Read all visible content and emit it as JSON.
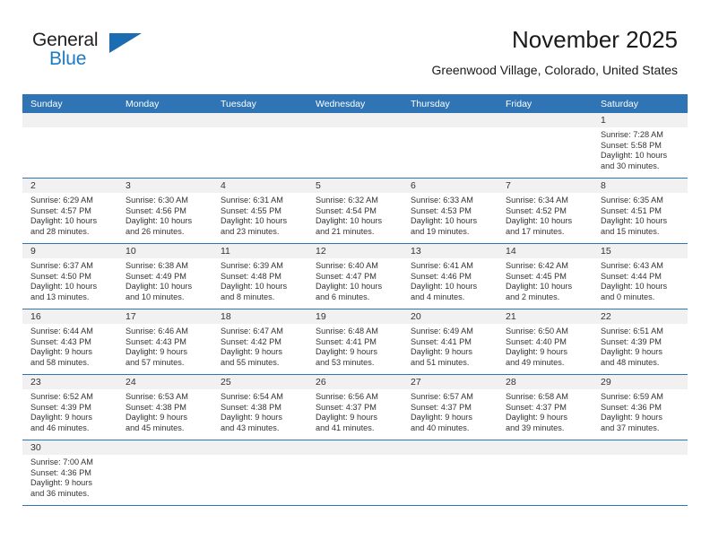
{
  "brand": {
    "name_top": "General",
    "name_bottom": "Blue",
    "accent_color": "#1b6cb0"
  },
  "header": {
    "title": "November 2025",
    "subtitle": "Greenwood Village, Colorado, United States"
  },
  "theme": {
    "header_row_bg": "#2f74b5",
    "daynum_bg": "#f1f1f1",
    "row_divider": "#2f74b5",
    "text": "#333333"
  },
  "weekday_headers": [
    "Sunday",
    "Monday",
    "Tuesday",
    "Wednesday",
    "Thursday",
    "Friday",
    "Saturday"
  ],
  "labels": {
    "sunrise": "Sunrise:",
    "sunset": "Sunset:",
    "daylight": "Daylight:"
  },
  "weeks": [
    [
      {
        "day": "",
        "blank": true
      },
      {
        "day": "",
        "blank": true
      },
      {
        "day": "",
        "blank": true
      },
      {
        "day": "",
        "blank": true
      },
      {
        "day": "",
        "blank": true
      },
      {
        "day": "",
        "blank": true
      },
      {
        "day": "1",
        "sunrise": "Sunrise: 7:28 AM",
        "sunset": "Sunset: 5:58 PM",
        "daylight1": "Daylight: 10 hours",
        "daylight2": "and 30 minutes."
      }
    ],
    [
      {
        "day": "2",
        "sunrise": "Sunrise: 6:29 AM",
        "sunset": "Sunset: 4:57 PM",
        "daylight1": "Daylight: 10 hours",
        "daylight2": "and 28 minutes."
      },
      {
        "day": "3",
        "sunrise": "Sunrise: 6:30 AM",
        "sunset": "Sunset: 4:56 PM",
        "daylight1": "Daylight: 10 hours",
        "daylight2": "and 26 minutes."
      },
      {
        "day": "4",
        "sunrise": "Sunrise: 6:31 AM",
        "sunset": "Sunset: 4:55 PM",
        "daylight1": "Daylight: 10 hours",
        "daylight2": "and 23 minutes."
      },
      {
        "day": "5",
        "sunrise": "Sunrise: 6:32 AM",
        "sunset": "Sunset: 4:54 PM",
        "daylight1": "Daylight: 10 hours",
        "daylight2": "and 21 minutes."
      },
      {
        "day": "6",
        "sunrise": "Sunrise: 6:33 AM",
        "sunset": "Sunset: 4:53 PM",
        "daylight1": "Daylight: 10 hours",
        "daylight2": "and 19 minutes."
      },
      {
        "day": "7",
        "sunrise": "Sunrise: 6:34 AM",
        "sunset": "Sunset: 4:52 PM",
        "daylight1": "Daylight: 10 hours",
        "daylight2": "and 17 minutes."
      },
      {
        "day": "8",
        "sunrise": "Sunrise: 6:35 AM",
        "sunset": "Sunset: 4:51 PM",
        "daylight1": "Daylight: 10 hours",
        "daylight2": "and 15 minutes."
      }
    ],
    [
      {
        "day": "9",
        "sunrise": "Sunrise: 6:37 AM",
        "sunset": "Sunset: 4:50 PM",
        "daylight1": "Daylight: 10 hours",
        "daylight2": "and 13 minutes."
      },
      {
        "day": "10",
        "sunrise": "Sunrise: 6:38 AM",
        "sunset": "Sunset: 4:49 PM",
        "daylight1": "Daylight: 10 hours",
        "daylight2": "and 10 minutes."
      },
      {
        "day": "11",
        "sunrise": "Sunrise: 6:39 AM",
        "sunset": "Sunset: 4:48 PM",
        "daylight1": "Daylight: 10 hours",
        "daylight2": "and 8 minutes."
      },
      {
        "day": "12",
        "sunrise": "Sunrise: 6:40 AM",
        "sunset": "Sunset: 4:47 PM",
        "daylight1": "Daylight: 10 hours",
        "daylight2": "and 6 minutes."
      },
      {
        "day": "13",
        "sunrise": "Sunrise: 6:41 AM",
        "sunset": "Sunset: 4:46 PM",
        "daylight1": "Daylight: 10 hours",
        "daylight2": "and 4 minutes."
      },
      {
        "day": "14",
        "sunrise": "Sunrise: 6:42 AM",
        "sunset": "Sunset: 4:45 PM",
        "daylight1": "Daylight: 10 hours",
        "daylight2": "and 2 minutes."
      },
      {
        "day": "15",
        "sunrise": "Sunrise: 6:43 AM",
        "sunset": "Sunset: 4:44 PM",
        "daylight1": "Daylight: 10 hours",
        "daylight2": "and 0 minutes."
      }
    ],
    [
      {
        "day": "16",
        "sunrise": "Sunrise: 6:44 AM",
        "sunset": "Sunset: 4:43 PM",
        "daylight1": "Daylight: 9 hours",
        "daylight2": "and 58 minutes."
      },
      {
        "day": "17",
        "sunrise": "Sunrise: 6:46 AM",
        "sunset": "Sunset: 4:43 PM",
        "daylight1": "Daylight: 9 hours",
        "daylight2": "and 57 minutes."
      },
      {
        "day": "18",
        "sunrise": "Sunrise: 6:47 AM",
        "sunset": "Sunset: 4:42 PM",
        "daylight1": "Daylight: 9 hours",
        "daylight2": "and 55 minutes."
      },
      {
        "day": "19",
        "sunrise": "Sunrise: 6:48 AM",
        "sunset": "Sunset: 4:41 PM",
        "daylight1": "Daylight: 9 hours",
        "daylight2": "and 53 minutes."
      },
      {
        "day": "20",
        "sunrise": "Sunrise: 6:49 AM",
        "sunset": "Sunset: 4:41 PM",
        "daylight1": "Daylight: 9 hours",
        "daylight2": "and 51 minutes."
      },
      {
        "day": "21",
        "sunrise": "Sunrise: 6:50 AM",
        "sunset": "Sunset: 4:40 PM",
        "daylight1": "Daylight: 9 hours",
        "daylight2": "and 49 minutes."
      },
      {
        "day": "22",
        "sunrise": "Sunrise: 6:51 AM",
        "sunset": "Sunset: 4:39 PM",
        "daylight1": "Daylight: 9 hours",
        "daylight2": "and 48 minutes."
      }
    ],
    [
      {
        "day": "23",
        "sunrise": "Sunrise: 6:52 AM",
        "sunset": "Sunset: 4:39 PM",
        "daylight1": "Daylight: 9 hours",
        "daylight2": "and 46 minutes."
      },
      {
        "day": "24",
        "sunrise": "Sunrise: 6:53 AM",
        "sunset": "Sunset: 4:38 PM",
        "daylight1": "Daylight: 9 hours",
        "daylight2": "and 45 minutes."
      },
      {
        "day": "25",
        "sunrise": "Sunrise: 6:54 AM",
        "sunset": "Sunset: 4:38 PM",
        "daylight1": "Daylight: 9 hours",
        "daylight2": "and 43 minutes."
      },
      {
        "day": "26",
        "sunrise": "Sunrise: 6:56 AM",
        "sunset": "Sunset: 4:37 PM",
        "daylight1": "Daylight: 9 hours",
        "daylight2": "and 41 minutes."
      },
      {
        "day": "27",
        "sunrise": "Sunrise: 6:57 AM",
        "sunset": "Sunset: 4:37 PM",
        "daylight1": "Daylight: 9 hours",
        "daylight2": "and 40 minutes."
      },
      {
        "day": "28",
        "sunrise": "Sunrise: 6:58 AM",
        "sunset": "Sunset: 4:37 PM",
        "daylight1": "Daylight: 9 hours",
        "daylight2": "and 39 minutes."
      },
      {
        "day": "29",
        "sunrise": "Sunrise: 6:59 AM",
        "sunset": "Sunset: 4:36 PM",
        "daylight1": "Daylight: 9 hours",
        "daylight2": "and 37 minutes."
      }
    ],
    [
      {
        "day": "30",
        "sunrise": "Sunrise: 7:00 AM",
        "sunset": "Sunset: 4:36 PM",
        "daylight1": "Daylight: 9 hours",
        "daylight2": "and 36 minutes."
      },
      {
        "day": "",
        "blank": true
      },
      {
        "day": "",
        "blank": true
      },
      {
        "day": "",
        "blank": true
      },
      {
        "day": "",
        "blank": true
      },
      {
        "day": "",
        "blank": true
      },
      {
        "day": "",
        "blank": true
      }
    ]
  ]
}
